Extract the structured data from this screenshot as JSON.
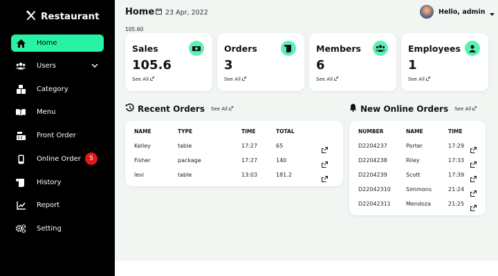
{
  "brand": {
    "name": "Restaurant",
    "icon": "fork-knife-icon"
  },
  "sidebar": {
    "items": [
      {
        "label": "Home",
        "icon": "home-icon",
        "active": true
      },
      {
        "label": "Users",
        "icon": "users-icon",
        "chevron": true
      },
      {
        "label": "Category",
        "icon": "category-icon"
      },
      {
        "label": "Menu",
        "icon": "book-icon"
      },
      {
        "label": "Front Order",
        "icon": "cash-register-icon"
      },
      {
        "label": "Online Order",
        "icon": "mobile-icon",
        "badge": "5"
      },
      {
        "label": "History",
        "icon": "scroll-icon"
      },
      {
        "label": "Report",
        "icon": "chart-line-icon"
      },
      {
        "label": "Setting",
        "icon": "gears-icon"
      }
    ]
  },
  "header": {
    "title": "Home",
    "date": "23 Apr, 2022",
    "sub_value": "105.60",
    "user_label": "Hello, admin"
  },
  "cards": [
    {
      "title": "Sales",
      "value": "105.6",
      "see_all": "See All",
      "icon": "money-icon"
    },
    {
      "title": "Orders",
      "value": "3",
      "see_all": "See All",
      "icon": "receipt-icon"
    },
    {
      "title": "Members",
      "value": "6",
      "see_all": "See All",
      "icon": "members-icon"
    },
    {
      "title": "Employees",
      "value": "1",
      "see_all": "See All",
      "icon": "employee-icon"
    }
  ],
  "recent_orders": {
    "title": "Recent Orders",
    "see_all": "See All",
    "columns": [
      "NAME",
      "TYPE",
      "TIME",
      "TOTAL"
    ],
    "rows": [
      [
        "Kelley",
        "table",
        "17:27",
        "65"
      ],
      [
        "Fisher",
        "package",
        "17:27",
        "140"
      ],
      [
        "levi",
        "table",
        "13:03",
        "181.2"
      ]
    ]
  },
  "online_orders": {
    "title": "New Online Orders",
    "see_all": "See All",
    "columns": [
      "NUMBER",
      "NAME",
      "TIME"
    ],
    "rows": [
      [
        "D2204237",
        "Porter",
        "17:29"
      ],
      [
        "D2204238",
        "Riley",
        "17:33"
      ],
      [
        "D2204239",
        "Scott",
        "17:39"
      ],
      [
        "D22042310",
        "Simmons",
        "21:24"
      ],
      [
        "D22042311",
        "Mendoza",
        "21:25"
      ]
    ]
  },
  "colors": {
    "accent": "#28f2a3",
    "icon_bg": "#5cf0b4",
    "sidebar": "#000000",
    "badge": "#e01818",
    "background": "#f2f6f3"
  }
}
